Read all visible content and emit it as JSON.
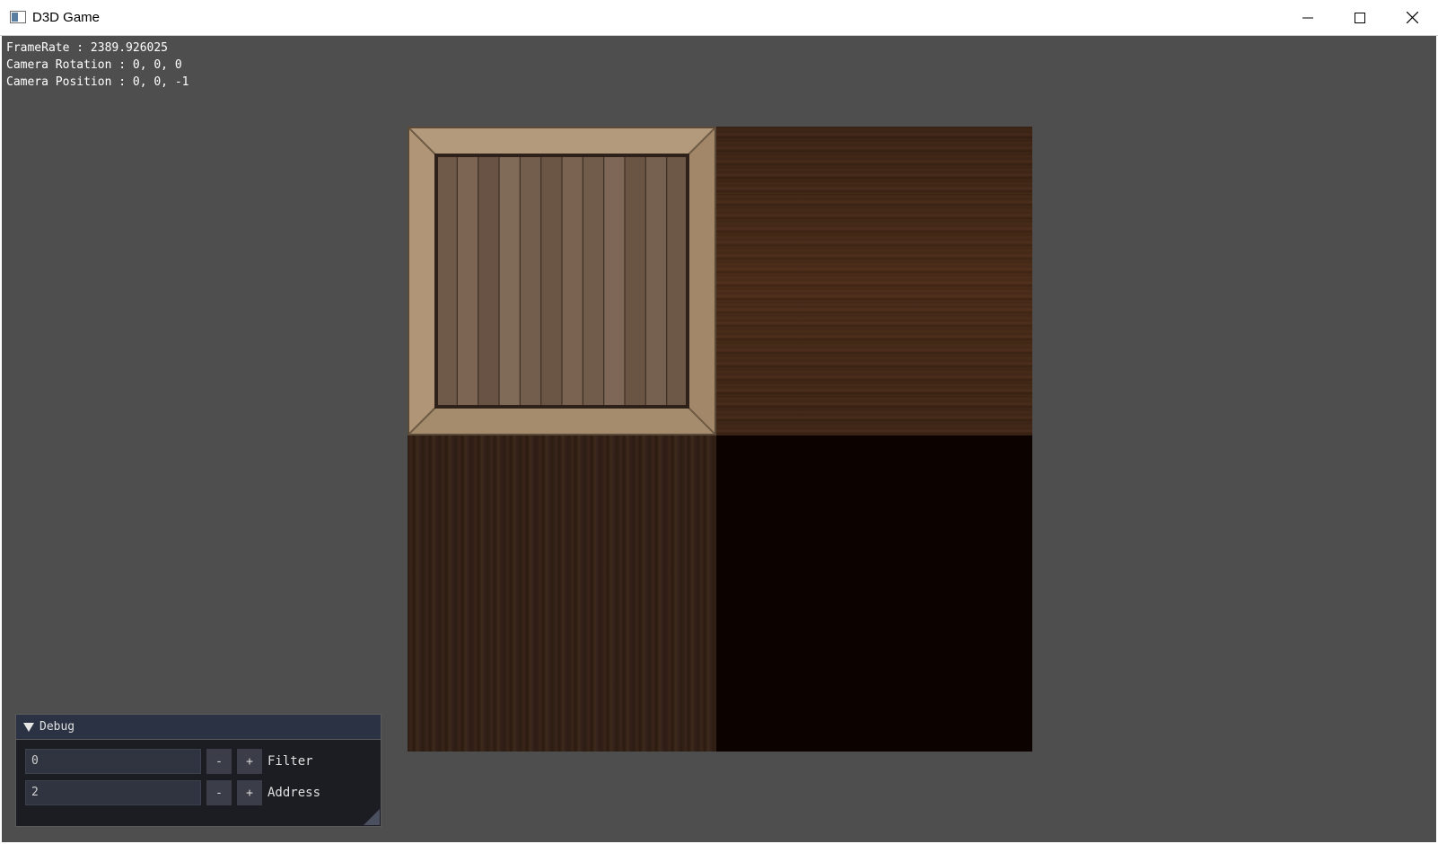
{
  "window": {
    "title": "D3D Game",
    "icon": "app-window-icon",
    "controls": [
      "minimize-icon",
      "maximize-icon",
      "close-icon"
    ]
  },
  "stats": {
    "framerate": "FrameRate : 2389.926025",
    "camera_rotation": "Camera Rotation : 0, 0, 0",
    "camera_position": "Camera Position : 0, 0, -1"
  },
  "debug_panel": {
    "title": "Debug",
    "rows": [
      {
        "value": "0",
        "minus": "-",
        "plus": "+",
        "label": "Filter"
      },
      {
        "value": "2",
        "minus": "-",
        "plus": "+",
        "label": "Address"
      }
    ]
  },
  "colors": {
    "client_bg": "#4e4e4e",
    "panel_bg": "#1c1d22",
    "panel_header": "#2b3243"
  }
}
